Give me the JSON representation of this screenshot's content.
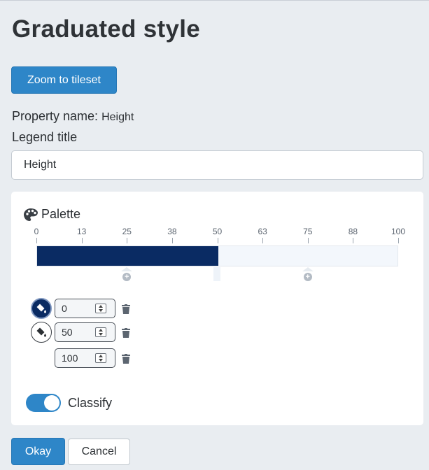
{
  "header": {
    "title": "Graduated style"
  },
  "toolbar": {
    "zoom_label": "Zoom to tileset"
  },
  "property": {
    "label": "Property name:",
    "value": "Height"
  },
  "legend": {
    "label": "Legend title",
    "value": "Height"
  },
  "palette": {
    "title": "Palette",
    "ticks": [
      "0",
      "13",
      "25",
      "38",
      "50",
      "63",
      "75",
      "88",
      "100"
    ],
    "bar": {
      "min": 0,
      "max": 100,
      "fill_to": 50,
      "fill_color": "#0a2b63",
      "track_color": "#f3f7fc"
    },
    "handles": [
      25,
      75
    ],
    "stops": [
      {
        "value": "0",
        "swatch": "dark",
        "color": "#0a2b63"
      },
      {
        "value": "50",
        "swatch": "light",
        "color": "#ffffff"
      },
      {
        "value": "100",
        "swatch": "none"
      }
    ]
  },
  "classify": {
    "label": "Classify",
    "enabled": true
  },
  "footer": {
    "okay_label": "Okay",
    "cancel_label": "Cancel"
  },
  "colors": {
    "accent": "#2e86c8",
    "dark_blue": "#0a2b63",
    "background": "#e9edf1"
  },
  "icons": {
    "palette": "palette-icon",
    "paint": "paint-bucket-icon",
    "delete": "trash-icon",
    "add": "plus-circle-icon"
  }
}
